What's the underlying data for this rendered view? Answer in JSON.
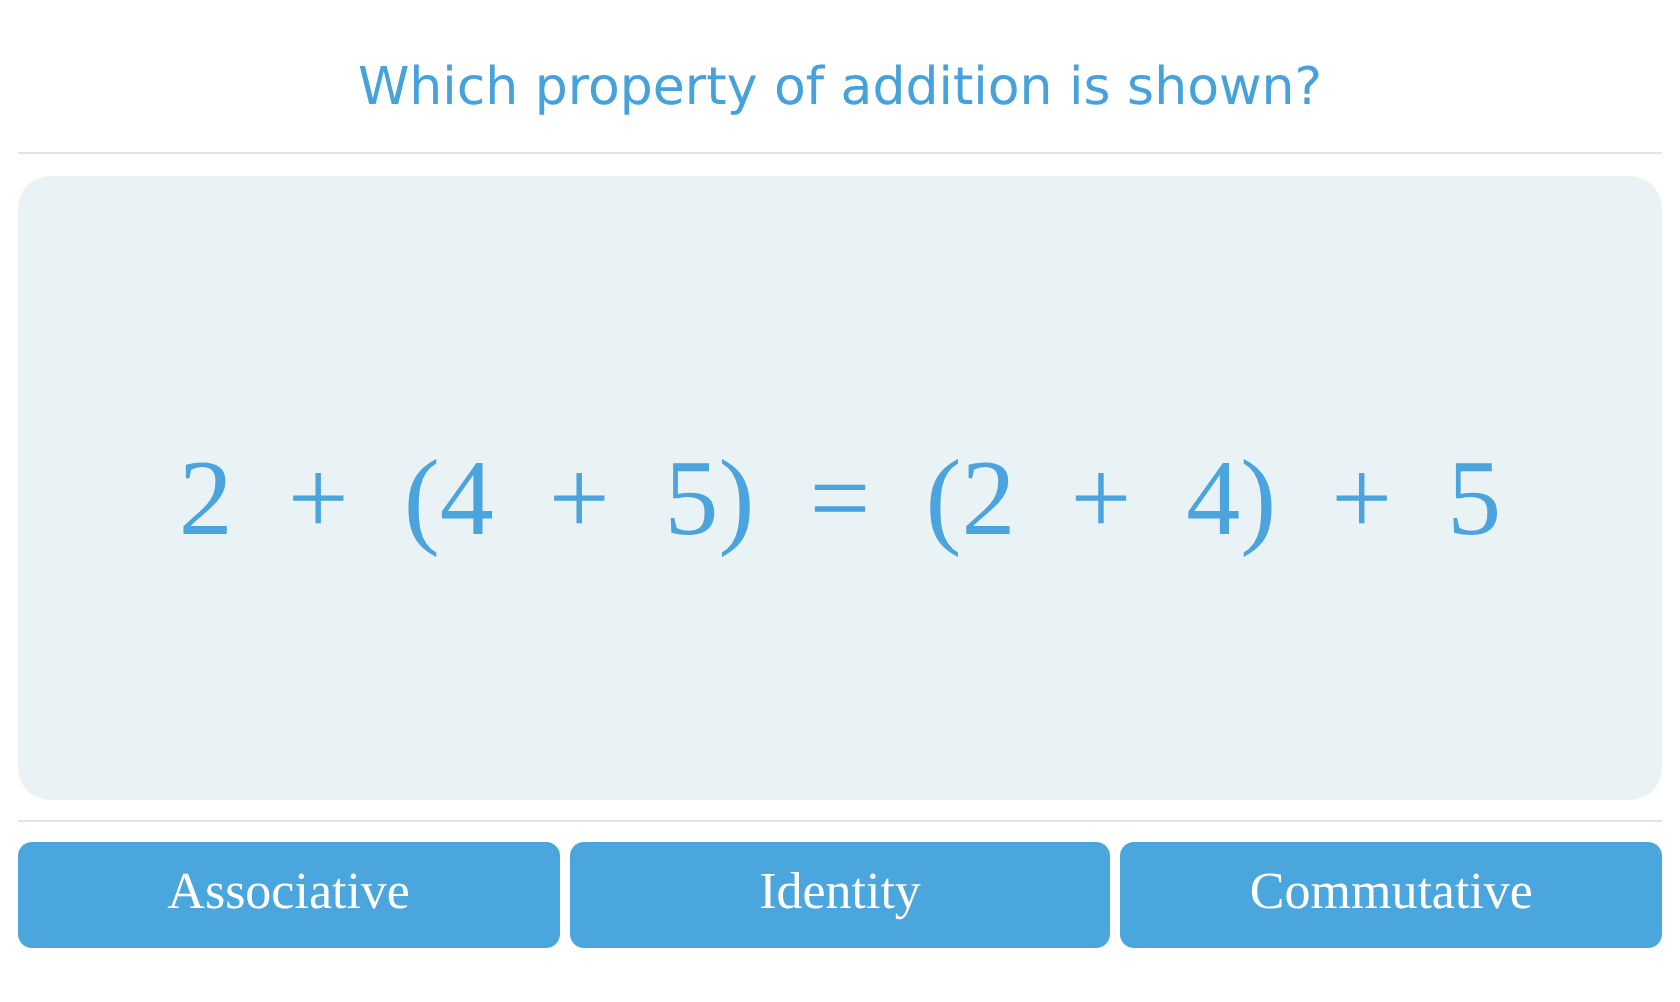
{
  "question": {
    "title": "Which property of addition is shown?"
  },
  "equation": "2 + (4 + 5) = (2 + 4) + 5",
  "answers": [
    {
      "label": "Associative"
    },
    {
      "label": "Identity"
    },
    {
      "label": "Commutative"
    }
  ]
}
